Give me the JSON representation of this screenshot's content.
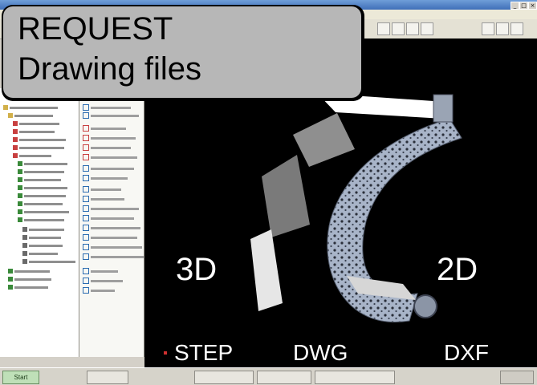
{
  "callout": {
    "title": "REQUEST",
    "subtitle": "Drawing files"
  },
  "formats": {
    "three_d": "3D",
    "two_d": "2D",
    "step": "STEP",
    "dwg": "DWG",
    "dxf": "DXF"
  },
  "colors": {
    "viewport_bg": "#000000",
    "callout_bg": "#b7b7b7",
    "model_link": "#a8b4c8",
    "model_cover": "#dcdcdc",
    "label_text": "#ffffff"
  }
}
